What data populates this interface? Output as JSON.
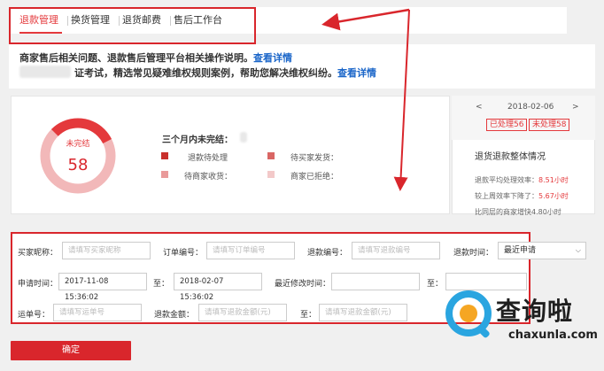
{
  "tabs": [
    {
      "label": "退款管理",
      "active": true
    },
    {
      "label": "换货管理",
      "active": false
    },
    {
      "label": "退货邮费",
      "active": false
    },
    {
      "label": "售后工作台",
      "active": false
    }
  ],
  "notices": {
    "line1_text": "商家售后相关问题、退款售后管理平台相关操作说明。",
    "line1_link": "查看详情",
    "line2_text": "证考试，精选常见疑难维权规则案例，帮助您解决维权纠纷。",
    "line2_link": "查看详情"
  },
  "ring": {
    "label": "未完结",
    "value": "58",
    "color_track": "#f2b8b9",
    "color_fill": "#e4393c"
  },
  "unfinished": {
    "title": "三个月内未完结：",
    "legend": [
      {
        "label": "退款待处理",
        "color": "#c9302c"
      },
      {
        "label": "待买家发货：",
        "color": "#d96664"
      },
      {
        "label": "待商家收货：",
        "color": "#e99a9a"
      },
      {
        "label": "商家已拒绝：",
        "color": "#f3c9c9"
      }
    ]
  },
  "side": {
    "prev": "<",
    "date": "2018-02-06",
    "next": ">",
    "processed": "已处理56",
    "unprocessed": "未处理58",
    "title": "退货退款整体情况",
    "stat1_label": "退款平均处理效率：",
    "stat1_value": "8.51小时",
    "stat2_label": "较上周效率下降了：",
    "stat2_value": "5.67小时",
    "stat3_label": "比同层的商家增快4.80小时"
  },
  "form": {
    "buyer_label": "买家昵称：",
    "buyer_placeholder": "请填写买家昵称",
    "order_label": "订单编号：",
    "order_placeholder": "请填写订单编号",
    "refund_no_label": "退款编号：",
    "refund_no_placeholder": "请填写退款编号",
    "refund_time_label": "退款时间：",
    "refund_time_value": "最近申请",
    "apply_time_label": "申请时间：",
    "apply_from": "2017-11-08 15:36:02",
    "to1": "至：",
    "apply_to": "2018-02-07 15:36:02",
    "modified_label": "最近修改时间：",
    "to2": "至：",
    "waybill_label": "运单号：",
    "waybill_placeholder": "请填写运单号",
    "amount_label": "退款金额：",
    "amount_placeholder": "请填写退款金额(元)",
    "to3": "至：",
    "amount_to_placeholder": "请填写退款金额(元)"
  },
  "confirm_label": "确定",
  "watermark": {
    "brand": "查询啦",
    "url": "chaxunla.com"
  },
  "colors": {
    "accent": "#e4393c",
    "link": "#1b66c9",
    "annotation": "#d9262c"
  }
}
